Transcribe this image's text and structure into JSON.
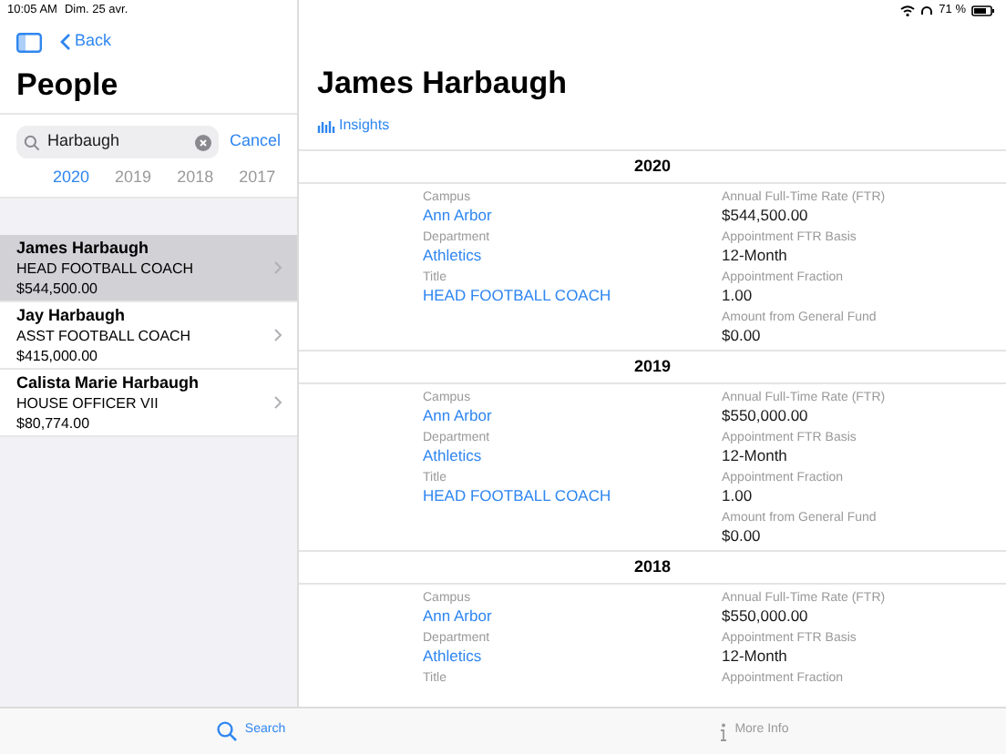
{
  "status_bar": {
    "time": "10:05 AM",
    "date": "Dim. 25 avr.",
    "battery": "71 %"
  },
  "sidebar": {
    "back": "Back",
    "title": "People",
    "search": {
      "value": "Harbaugh",
      "cancel": "Cancel"
    },
    "years": [
      {
        "label": "2020",
        "selected": true
      },
      {
        "label": "2019",
        "selected": false
      },
      {
        "label": "2018",
        "selected": false
      },
      {
        "label": "2017",
        "selected": false
      }
    ],
    "results": [
      {
        "name": "James Harbaugh",
        "title": "HEAD FOOTBALL COACH",
        "salary": "$544,500.00",
        "selected": true
      },
      {
        "name": "Jay Harbaugh",
        "title": "ASST FOOTBALL COACH",
        "salary": "$415,000.00",
        "selected": false
      },
      {
        "name": "Calista Marie Harbaugh",
        "title": "HOUSE OFFICER VII",
        "salary": "$80,774.00",
        "selected": false
      }
    ]
  },
  "detail": {
    "name": "James Harbaugh",
    "insights": "Insights",
    "sections": [
      {
        "year": "2020",
        "left": [
          {
            "label": "Campus",
            "value": "Ann Arbor"
          },
          {
            "label": "Department",
            "value": "Athletics"
          },
          {
            "label": "Title",
            "value": "HEAD FOOTBALL COACH"
          }
        ],
        "right": [
          {
            "label": "Annual Full-Time Rate (FTR)",
            "value": "$544,500.00"
          },
          {
            "label": "Appointment FTR Basis",
            "value": "12-Month"
          },
          {
            "label": "Appointment Fraction",
            "value": "1.00"
          },
          {
            "label": "Amount from General Fund",
            "value": "$0.00"
          }
        ]
      },
      {
        "year": "2019",
        "left": [
          {
            "label": "Campus",
            "value": "Ann Arbor"
          },
          {
            "label": "Department",
            "value": "Athletics"
          },
          {
            "label": "Title",
            "value": "HEAD FOOTBALL COACH"
          }
        ],
        "right": [
          {
            "label": "Annual Full-Time Rate (FTR)",
            "value": "$550,000.00"
          },
          {
            "label": "Appointment FTR Basis",
            "value": "12-Month"
          },
          {
            "label": "Appointment Fraction",
            "value": "1.00"
          },
          {
            "label": "Amount from General Fund",
            "value": "$0.00"
          }
        ]
      },
      {
        "year": "2018",
        "left": [
          {
            "label": "Campus",
            "value": "Ann Arbor"
          },
          {
            "label": "Department",
            "value": "Athletics"
          },
          {
            "label": "Title"
          }
        ],
        "right": [
          {
            "label": "Annual Full-Time Rate (FTR)",
            "value": "$550,000.00"
          },
          {
            "label": "Appointment FTR Basis",
            "value": "12-Month"
          },
          {
            "label": "Appointment Fraction"
          }
        ]
      }
    ]
  },
  "tab_bar": [
    {
      "label": "Search",
      "selected": true
    },
    {
      "label": "More Info",
      "selected": false
    }
  ]
}
